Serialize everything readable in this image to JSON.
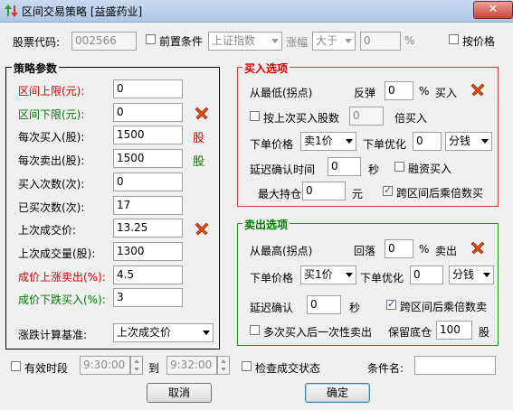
{
  "window": {
    "title": "区间交易策略 [益盛药业]",
    "close": "✕"
  },
  "top": {
    "stock_code_label": "股票代码:",
    "stock_code": "002566",
    "precondition_label": "前置条件",
    "index_select": "上证指数",
    "change_label": "涨幅",
    "compare_select": "大于",
    "change_value": "0",
    "percent": "%",
    "by_price_label": "按价格"
  },
  "strategy": {
    "title": "策略参数",
    "rows": [
      {
        "label": "区间上限(元):",
        "value": "0"
      },
      {
        "label": "区间下限(元):",
        "value": "0"
      },
      {
        "label": "每次买入(股):",
        "value": "1500",
        "tag": "股"
      },
      {
        "label": "每次卖出(股):",
        "value": "1500",
        "tag": "股"
      },
      {
        "label": "买入次数(次):",
        "value": "0"
      },
      {
        "label": "已买次数(次):",
        "value": "17"
      },
      {
        "label": "上次成交价:",
        "value": "13.25"
      },
      {
        "label": "上次成交量(股):",
        "value": "1300"
      },
      {
        "label": "成价上涨卖出(%):",
        "value": "4.5"
      },
      {
        "label": "成价下跌买入(%):",
        "value": "3"
      }
    ],
    "basis_label": "涨跌计算基准:",
    "basis_select": "上次成交价"
  },
  "buy": {
    "title": "买入选项",
    "from_low": "从最低(拐点)",
    "rebound_label": "反弹",
    "rebound_value": "0",
    "percent": "%",
    "buy_label": "买入",
    "by_last_qty": "按上次买入股数",
    "multiplier_value": "0",
    "times_buy": "倍买入",
    "order_price_label": "下单价格",
    "order_price_select": "卖1价",
    "order_opt_label": "下单优化",
    "order_opt_value": "0",
    "unit_select": "分钱",
    "delay_label": "延迟确认时间",
    "delay_value": "0",
    "sec": "秒",
    "margin_buy": "融资买入",
    "max_pos_label": "最大持仓",
    "max_pos_value": "0",
    "yuan": "元",
    "multi_buy": "跨区间后乘倍数买"
  },
  "sell": {
    "title": "卖出选项",
    "from_high": "从最高(拐点)",
    "pullback_label": "回落",
    "pullback_value": "0",
    "percent": "%",
    "sell_label": "卖出",
    "order_price_label": "下单价格",
    "order_price_select": "买1价",
    "order_opt_label": "下单优化",
    "order_opt_value": "0",
    "unit_select": "分钱",
    "delay_label": "延迟确认",
    "delay_value": "0",
    "sec": "秒",
    "multi_sell": "跨区间后乘倍数卖",
    "one_time_sell": "多次买入后一次性卖出",
    "keep_base_label": "保留底仓",
    "keep_base_value": "100",
    "share": "股"
  },
  "bottom": {
    "valid_period": "有效时段",
    "time_from": "9:30:00",
    "to_label": "到",
    "time_to": "9:32:00",
    "check_status": "检查成交状态",
    "condition_name_label": "条件名:",
    "condition_name": "",
    "cancel": "取消",
    "ok": "确定"
  },
  "colors": {
    "buy_border": "#d04040",
    "sell_border": "#2a8a2a",
    "red_label": "#d00000",
    "green_label": "#007a00"
  }
}
